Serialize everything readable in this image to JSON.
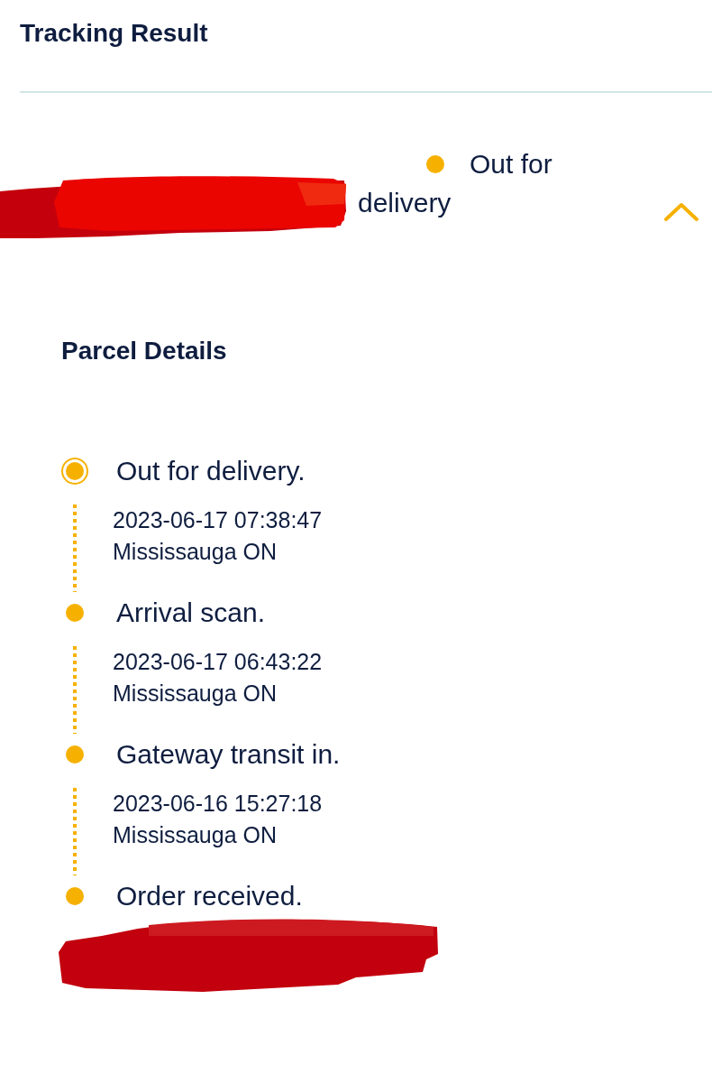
{
  "title": "Tracking Result",
  "shipment": {
    "redacted": true,
    "status": "Out for delivery",
    "expanded": true
  },
  "parcel_details": {
    "heading": "Parcel Details",
    "events": [
      {
        "title": "Out for delivery.",
        "current": true,
        "redacted": false,
        "datetime": "2023-06-17 07:38:47",
        "location": "Mississauga ON"
      },
      {
        "title": "Arrival scan.",
        "current": false,
        "redacted": false,
        "datetime": "2023-06-17 06:43:22",
        "location": "Mississauga ON"
      },
      {
        "title": "Gateway transit in.",
        "current": false,
        "redacted": false,
        "datetime": "2023-06-16 15:27:18",
        "location": "Mississauga ON"
      },
      {
        "title": "Order received.",
        "current": false,
        "redacted": true
      }
    ]
  }
}
